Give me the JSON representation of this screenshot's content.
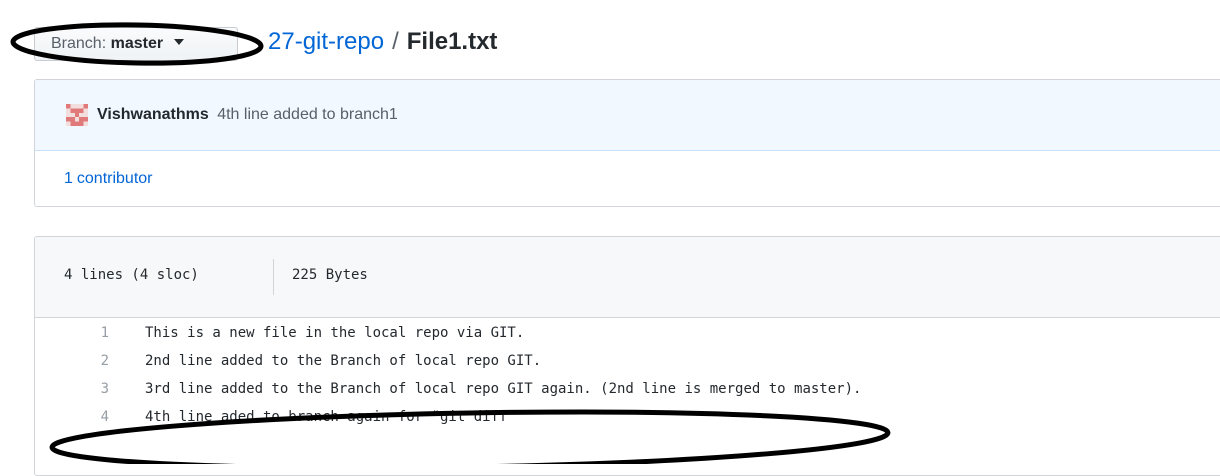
{
  "branch": {
    "prefix": "Branch:",
    "value": "master"
  },
  "breadcrumb": {
    "repo": "27-git-repo",
    "separator": "/",
    "file": "File1.txt"
  },
  "commit": {
    "author": "Vishwanathms",
    "message": "4th line added to branch1"
  },
  "contributors": {
    "count": "1",
    "label": "contributor"
  },
  "file_info": {
    "lines": "4 lines (4 sloc)",
    "size": "225 Bytes"
  },
  "code_lines": [
    {
      "num": "1",
      "text": "This is a new file in the local repo via GIT."
    },
    {
      "num": "2",
      "text": "2nd line added to the Branch of local repo GIT."
    },
    {
      "num": "3",
      "text": "3rd line added to the Branch of local repo GIT again. (2nd line is merged to master)."
    },
    {
      "num": "4",
      "text": "4th line aded to branch again for \"git diff\""
    }
  ],
  "colors": {
    "link": "#0366d6",
    "commit_bg": "#f1f8ff",
    "header_bg": "#f6f8fa",
    "annotation": "#000000"
  }
}
